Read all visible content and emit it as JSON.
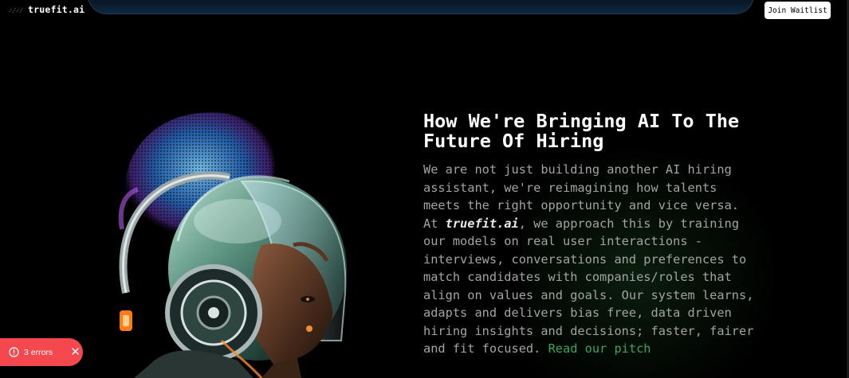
{
  "header": {
    "brand": "truefit.ai",
    "join_label": "Join Waitlist"
  },
  "hero": {
    "image_icon": "ai-woman-headphones-illustration"
  },
  "content": {
    "heading_line1": "How We're Bringing AI To The",
    "heading_line2": "Future Of Hiring",
    "body_before": "We are not just building another AI hiring assistant, we're reimagining how talents meets the right opportunity and vice versa. At ",
    "brand_inline": "truefit.ai",
    "body_after": ", we approach this by training our models on real user interactions - interviews, conversations and preferences to match candidates with companies/roles that align on values and goals. Our system learns, adapts and delivers bias free, data driven hiring insights and decisions; faster, fairer and fit focused. ",
    "link_label": "Read our pitch"
  },
  "error_toast": {
    "label": "3 errors",
    "icon": "alert-circle-icon",
    "close_icon": "close-icon"
  },
  "colors": {
    "background": "#000000",
    "link": "#3ba55c",
    "body_text": "#a3a3a3",
    "error": "#f5484e"
  }
}
